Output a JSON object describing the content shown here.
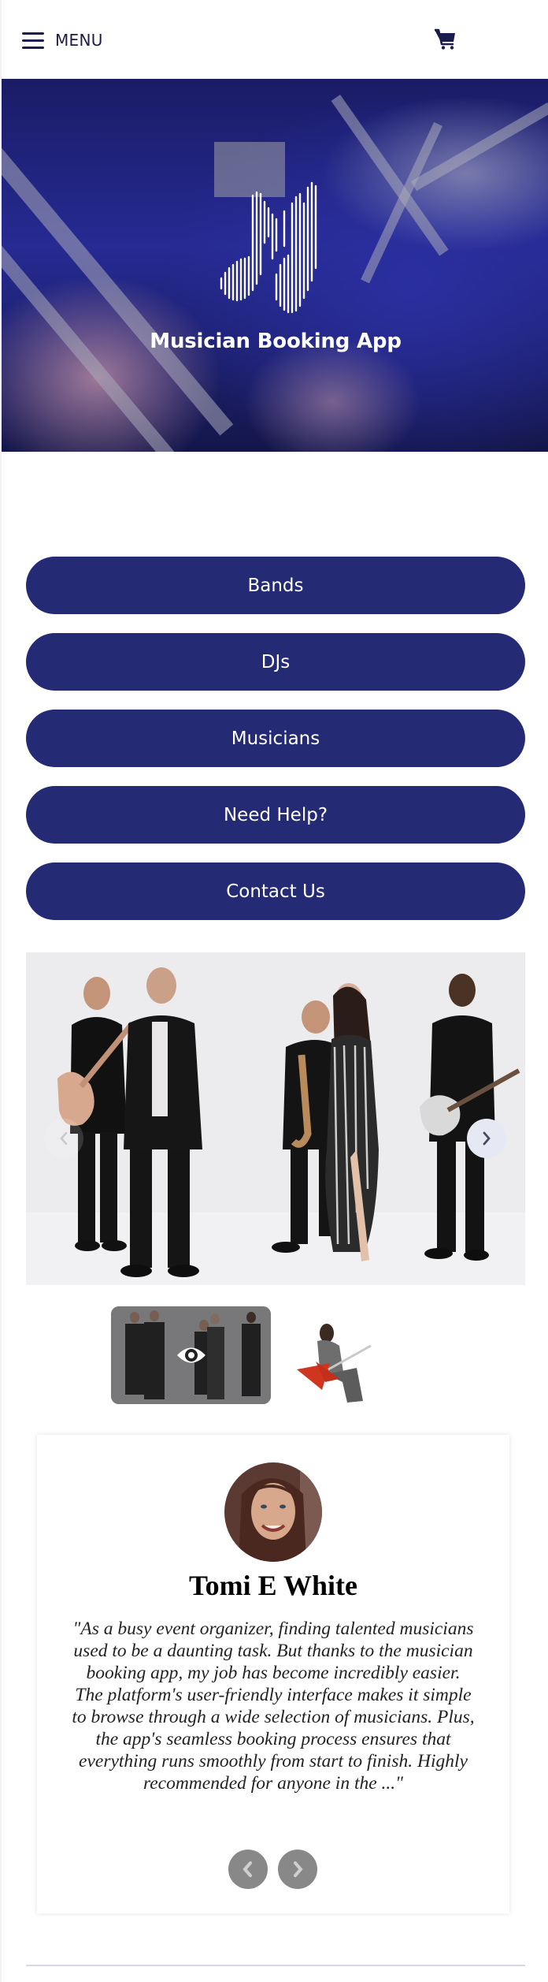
{
  "header": {
    "menu_label": "MENU",
    "menu_icon": "hamburger-icon",
    "cart_icon": "shopping-cart-icon"
  },
  "hero": {
    "logo_icon": "music-note-logo-icon",
    "title": "Musician Booking App"
  },
  "nav_buttons": [
    {
      "label": "Bands"
    },
    {
      "label": "DJs"
    },
    {
      "label": "Musicians"
    },
    {
      "label": "Need Help?"
    },
    {
      "label": "Contact Us"
    }
  ],
  "carousel": {
    "prev_icon": "chevron-left-icon",
    "next_icon": "chevron-right-icon",
    "current_slide": 1,
    "slide_count": 2,
    "thumbnails": [
      {
        "description": "band of five performers",
        "selected": true,
        "overlay_icon": "eye-icon"
      },
      {
        "description": "guitarist with red guitar",
        "selected": false
      }
    ]
  },
  "testimonial": {
    "name": "Tomi E White",
    "quote": "\"As a busy event organizer, finding talented musicians used to be a daunting task. But thanks to the musician booking app, my job has become incredibly easier. The platform's user-friendly interface makes it simple to browse through a wide selection of musicians. Plus, the app's seamless booking process ensures that everything runs smoothly from start to finish. Highly recommended for anyone in the ...\"",
    "prev_icon": "chevron-left-icon",
    "next_icon": "chevron-right-icon"
  },
  "colors": {
    "brand_navy": "#252a75",
    "text_navy": "#1b1b4d",
    "divider": "#d7d5ec",
    "arrow_gray": "#888888"
  }
}
